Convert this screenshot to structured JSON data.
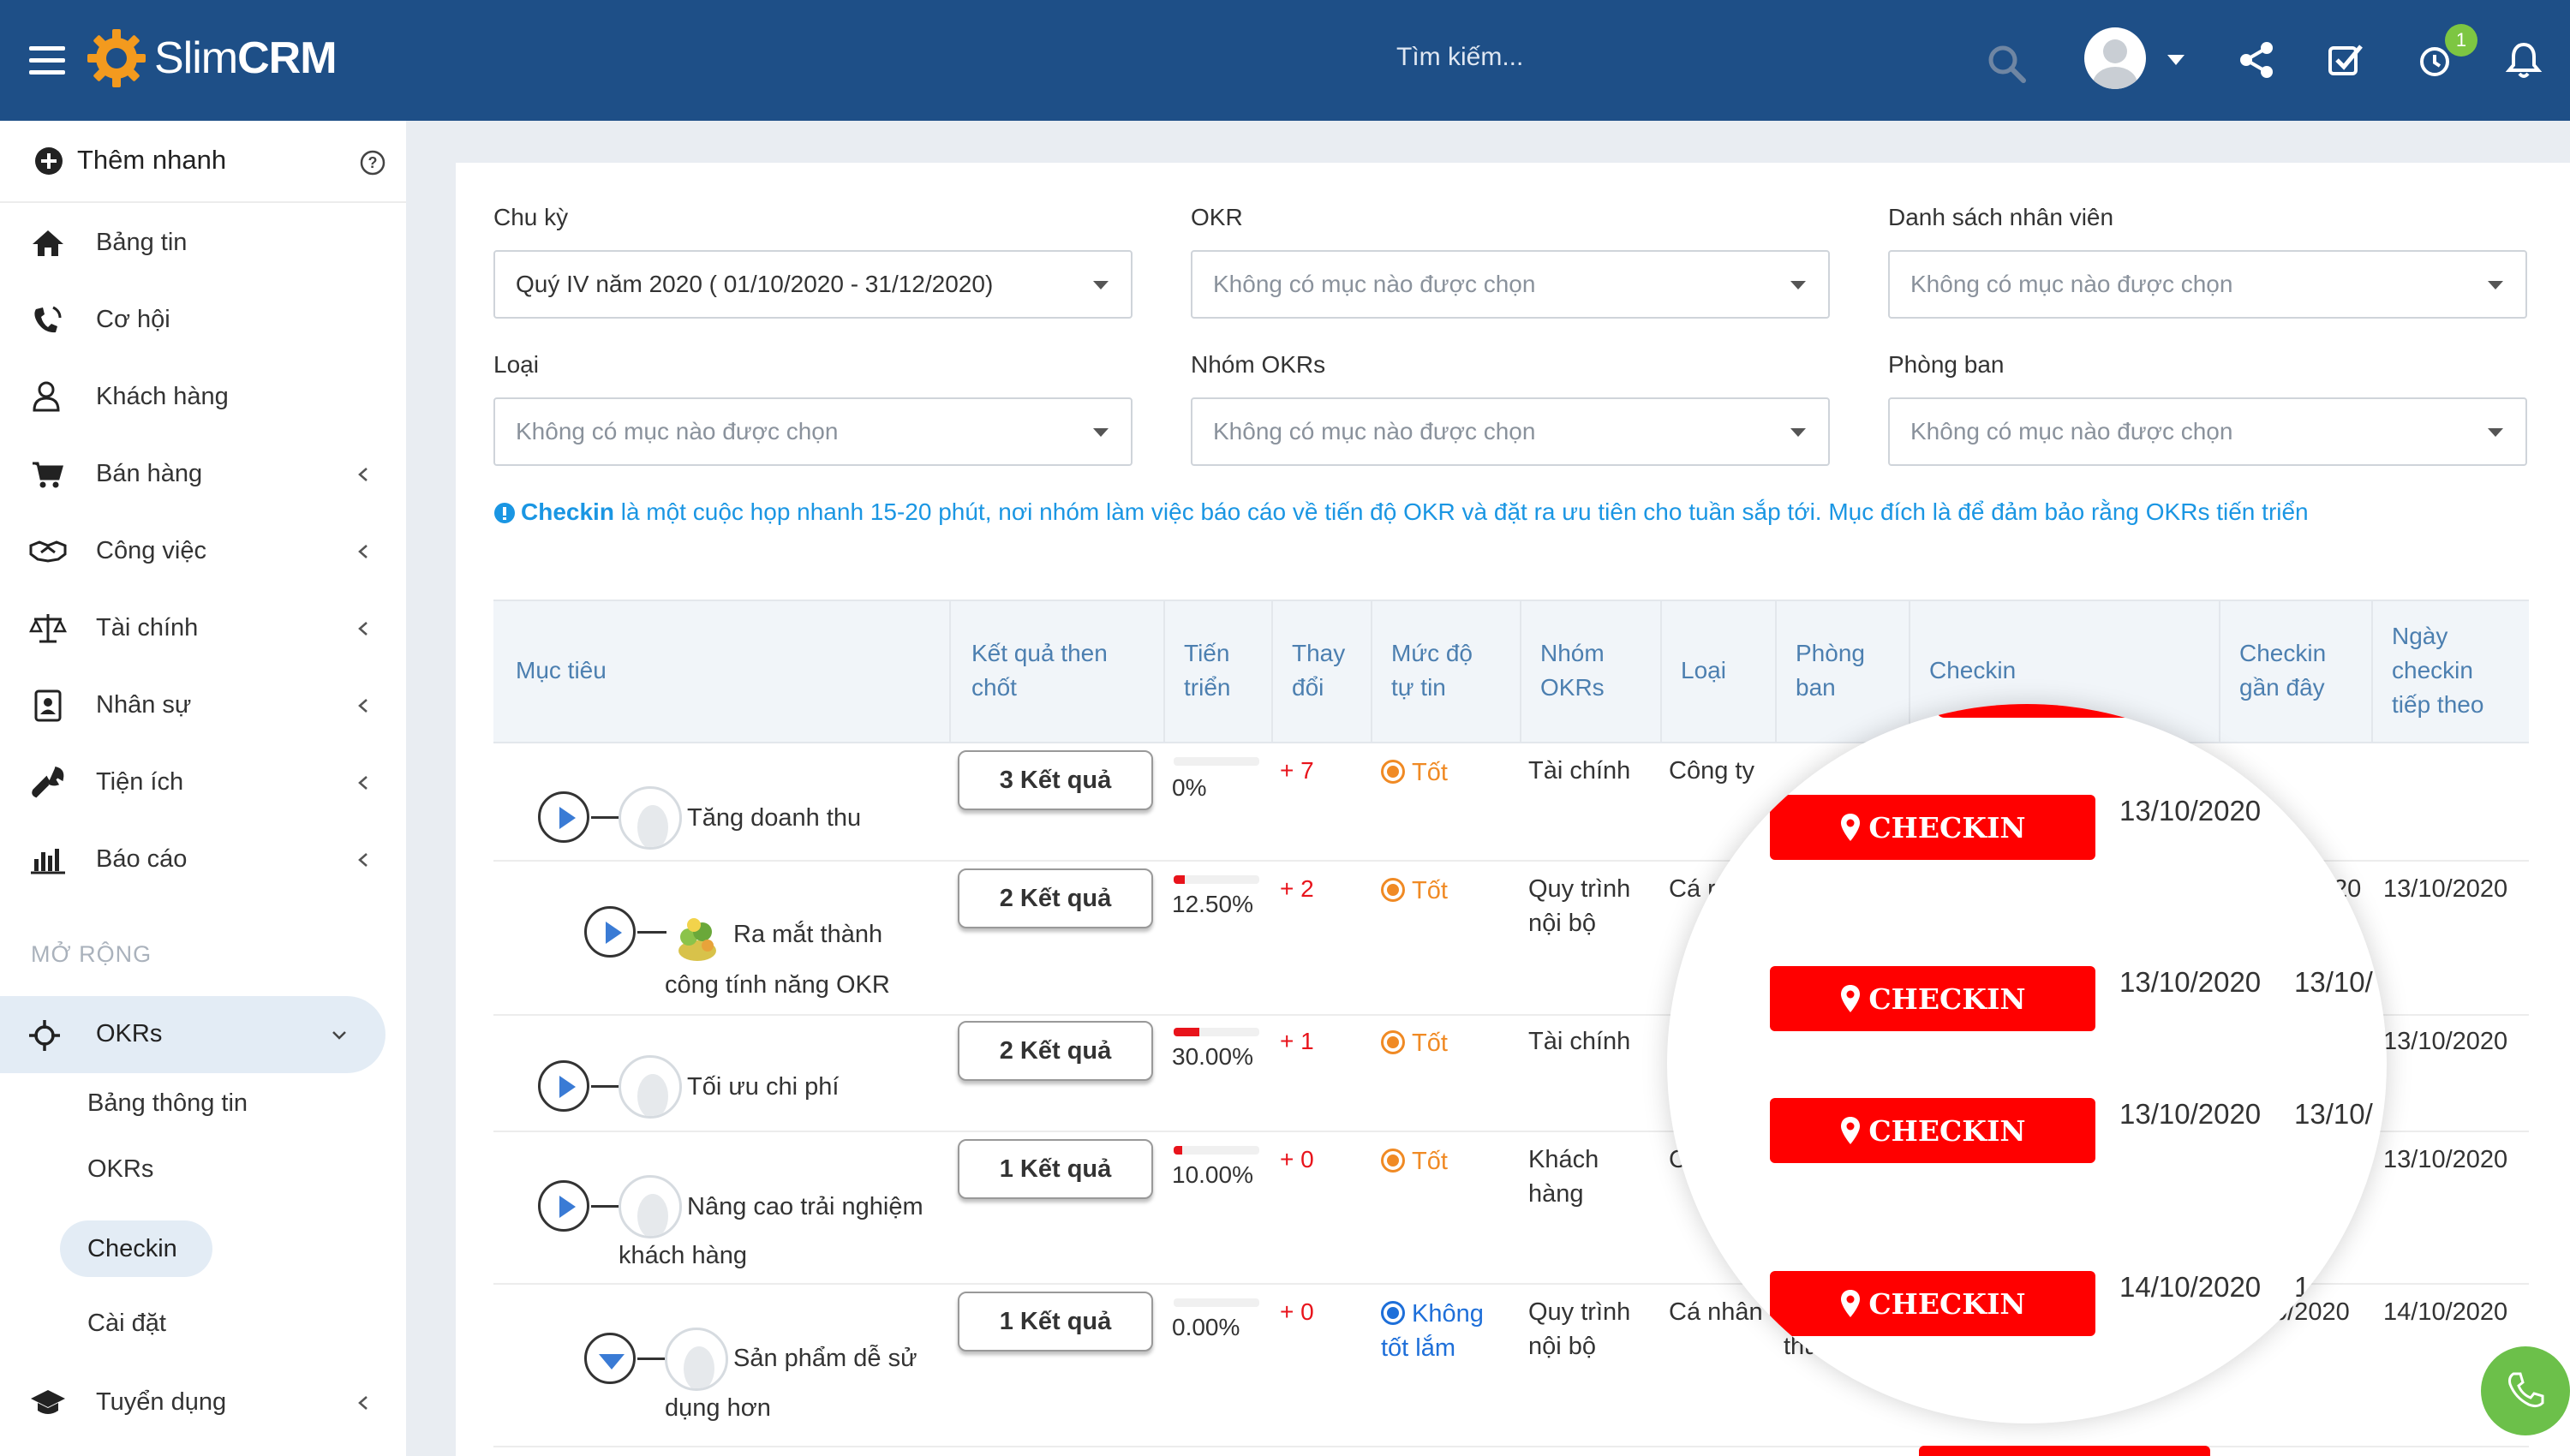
{
  "header": {
    "logo_plain": "Slim",
    "logo_bold": "CRM",
    "search_placeholder": "Tìm kiếm...",
    "notification_count": "1"
  },
  "sidebar": {
    "quick_add": "Thêm nhanh",
    "items": [
      {
        "label": "Bảng tin",
        "icon": "home-icon"
      },
      {
        "label": "Cơ hội",
        "icon": "phone-icon"
      },
      {
        "label": "Khách hàng",
        "icon": "user-icon"
      },
      {
        "label": "Bán hàng",
        "icon": "cart-icon"
      },
      {
        "label": "Công việc",
        "icon": "handshake-icon"
      },
      {
        "label": "Tài chính",
        "icon": "scale-icon"
      },
      {
        "label": "Nhân sự",
        "icon": "contact-icon"
      },
      {
        "label": "Tiện ích",
        "icon": "wrench-icon"
      },
      {
        "label": "Báo cáo",
        "icon": "bar-chart-icon"
      }
    ],
    "section": "MỞ RỘNG",
    "okrs": "OKRs",
    "sub_items": [
      "Bảng thông tin",
      "OKRs",
      "Checkin",
      "Cài đặt"
    ],
    "recruit": "Tuyển dụng"
  },
  "filters": {
    "cycle_label": "Chu kỳ",
    "cycle_value": "Quý IV năm 2020 ( 01/10/2020 - 31/12/2020)",
    "okr_label": "OKR",
    "staff_label": "Danh sách nhân viên",
    "type_label": "Loại",
    "group_label": "Nhóm OKRs",
    "dept_label": "Phòng ban",
    "empty": "Không có mục nào được chọn"
  },
  "info": {
    "bold": "Checkin",
    "text": " là một cuộc họp nhanh 15-20 phút, nơi nhóm làm việc báo cáo về tiến độ OKR và đặt ra ưu tiên cho tuần sắp tới. Mục đích là để đảm bảo rằng OKRs tiến triển"
  },
  "table": {
    "headers": {
      "goal": "Mục tiêu",
      "kr": [
        "Kết quả then",
        "chốt"
      ],
      "progress": [
        "Tiến",
        "triển"
      ],
      "change": [
        "Thay",
        "đổi"
      ],
      "confidence": [
        "Mức độ",
        "tự tin"
      ],
      "group": [
        "Nhóm",
        "OKRs"
      ],
      "type": "Loại",
      "dept": [
        "Phòng",
        "ban"
      ],
      "checkin": "Checkin",
      "recent": [
        "Checkin",
        "gần đây"
      ],
      "next": [
        "Ngày",
        "checkin",
        "tiếp theo"
      ]
    },
    "rows": [
      {
        "goal": [
          "Tăng doanh thu"
        ],
        "kr": "3 Kết quả",
        "progress": "0%",
        "progress_fraction": 0.0,
        "change": "+ 7",
        "confidence": [
          "Tốt"
        ],
        "group": [
          "Tài chính"
        ],
        "type": "Công ty"
      },
      {
        "goal": [
          "Ra mắt thành",
          "công tính năng OKR"
        ],
        "kr": "2 Kết quả",
        "progress": "12.50%",
        "progress_fraction": 0.125,
        "change": "+ 2",
        "confidence": [
          "Tốt"
        ],
        "group": [
          "Quy trình",
          "nội bộ"
        ],
        "type": "Cá r",
        "next_partial": "20",
        "next": "13/10/2020"
      },
      {
        "goal": [
          "Tối ưu chi phí"
        ],
        "kr": "2 Kết quả",
        "progress": "30.00%",
        "progress_fraction": 0.3,
        "change": "+ 1",
        "confidence": [
          "Tốt"
        ],
        "group": [
          "Tài chính"
        ],
        "type": "",
        "next": "13/10/2020"
      },
      {
        "goal": [
          "Nâng cao trải nghiệm",
          "khách hàng"
        ],
        "kr": "1 Kết quả",
        "progress": "10.00%",
        "progress_fraction": 0.1,
        "change": "+ 0",
        "confidence": [
          "Tốt"
        ],
        "group": [
          "Khách",
          "hàng"
        ],
        "type": "C",
        "next": "13/10/2020"
      },
      {
        "goal": [
          "Sản phẩm dễ sử",
          "dụng hơn"
        ],
        "kr": "1 Kết quả",
        "progress": "0.00%",
        "progress_fraction": 0.0,
        "change": "+ 0",
        "confidence": [
          "Không",
          "tốt lắm"
        ],
        "group": [
          "Quy trình",
          "nội bộ"
        ],
        "type": "Cá nhân",
        "dept_partial": "thu",
        "next_partial": "0/2020",
        "next": "14/10/2020"
      }
    ]
  },
  "magnifier": {
    "button": "CHECKIN",
    "rows": [
      {
        "recent": "13/10/2020",
        "next": ""
      },
      {
        "recent": "13/10/2020",
        "next": "13/10/"
      },
      {
        "recent": "13/10/2020",
        "next": "13/10/"
      },
      {
        "recent": "14/10/2020",
        "next": "1"
      }
    ]
  },
  "colors": {
    "header_bg": "#1e4f87",
    "accent_blue": "#1a96e3",
    "checkin_red": "#ff0000",
    "confidence_orange": "#f08a24",
    "call_green": "#6cc04a"
  }
}
